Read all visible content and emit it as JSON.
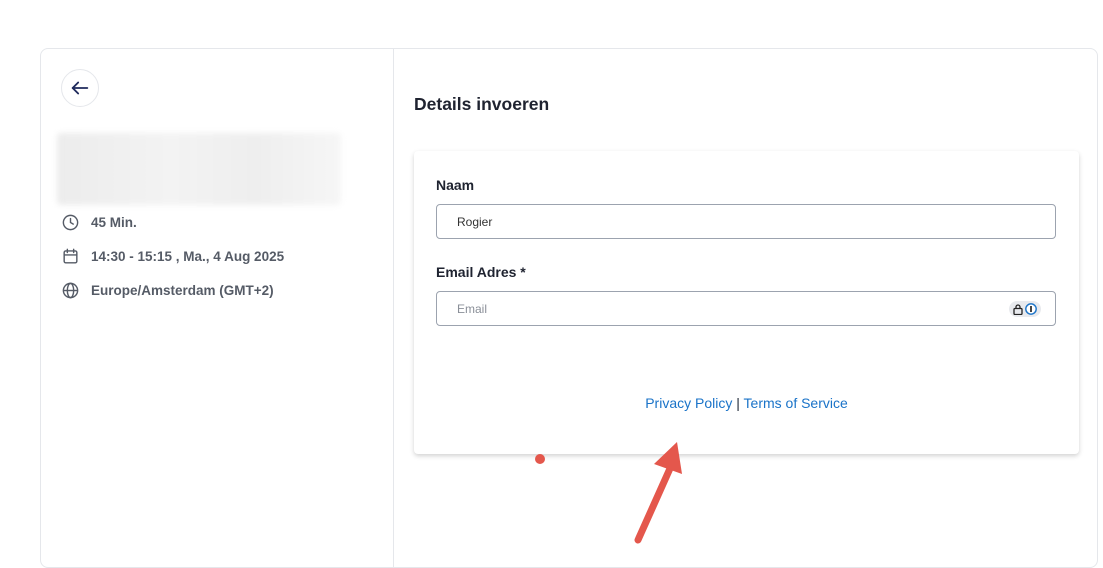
{
  "sidebar": {
    "duration": "45 Min.",
    "datetime": "14:30 - 15:15 , Ma., 4 Aug 2025",
    "timezone": "Europe/Amsterdam (GMT+2)"
  },
  "main": {
    "title": "Details invoeren",
    "form": {
      "name_label": "Naam",
      "name_value": "Rogier",
      "email_label": "Email Adres *",
      "email_placeholder": "Email"
    },
    "links": {
      "privacy": "Privacy Policy",
      "separator": "|",
      "terms": "Terms of Service"
    }
  },
  "colors": {
    "link": "#1a73c8",
    "annotation": "#e4574c"
  }
}
